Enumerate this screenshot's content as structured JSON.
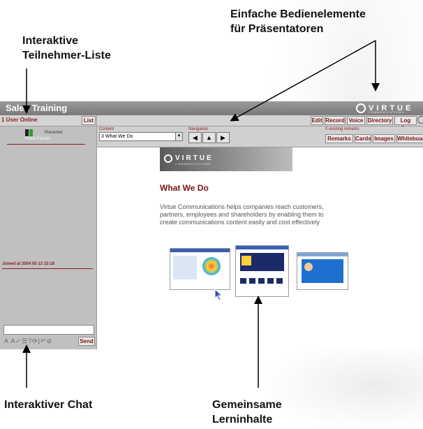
{
  "annotations": {
    "participants": [
      "Interaktive",
      "Teilnehmer-Liste"
    ],
    "controls": [
      "Einfache Bedienelemente",
      "für Präsentatoren"
    ],
    "chat": "Interaktiver Chat",
    "content": [
      "Gemeinsame",
      "Lerninhalte"
    ]
  },
  "app": {
    "title": "Sales Training",
    "logo_text": "VIRTUE",
    "logo_sub": "COMMUNICATIONS"
  },
  "left_panel": {
    "users_online": "1 User Online",
    "list_button": "List",
    "user": {
      "role": "Presenter",
      "name": "Rosie Ferson"
    },
    "joined": "Joined at 2004 05 13 15:18",
    "send_button": "Send",
    "chat_tools": "A A✓☰?⟳|↶⊘",
    "chat_icons": [
      "user-icon",
      "font-icon",
      "check-icon",
      "list-icon",
      "help-icon",
      "refresh-icon",
      "undo-icon",
      "clear-icon"
    ]
  },
  "toolbar": {
    "buttons": [
      "Edit",
      "Record",
      "Voice",
      "Directory",
      "Log Out"
    ]
  },
  "controls": {
    "content_label": "Content",
    "content_value": "3 What We Do",
    "navigation_label": "Navigation",
    "remarks_label": "0 existing remarks",
    "buttons": [
      "Remarks",
      "Cards",
      "Images",
      "Whiteboard"
    ]
  },
  "slide": {
    "logo_text": "VIRTUE",
    "logo_sub": "COMMUNICATIONS",
    "title": "What We Do",
    "body": "Virtue Communications helps companies reach customers, partners, employees and shareholders by enabling them to create communications content easily and cost effectively"
  },
  "colors": {
    "accent": "#8b1a1a",
    "panel": "#c0c0c0",
    "titlebar": "#888888"
  }
}
